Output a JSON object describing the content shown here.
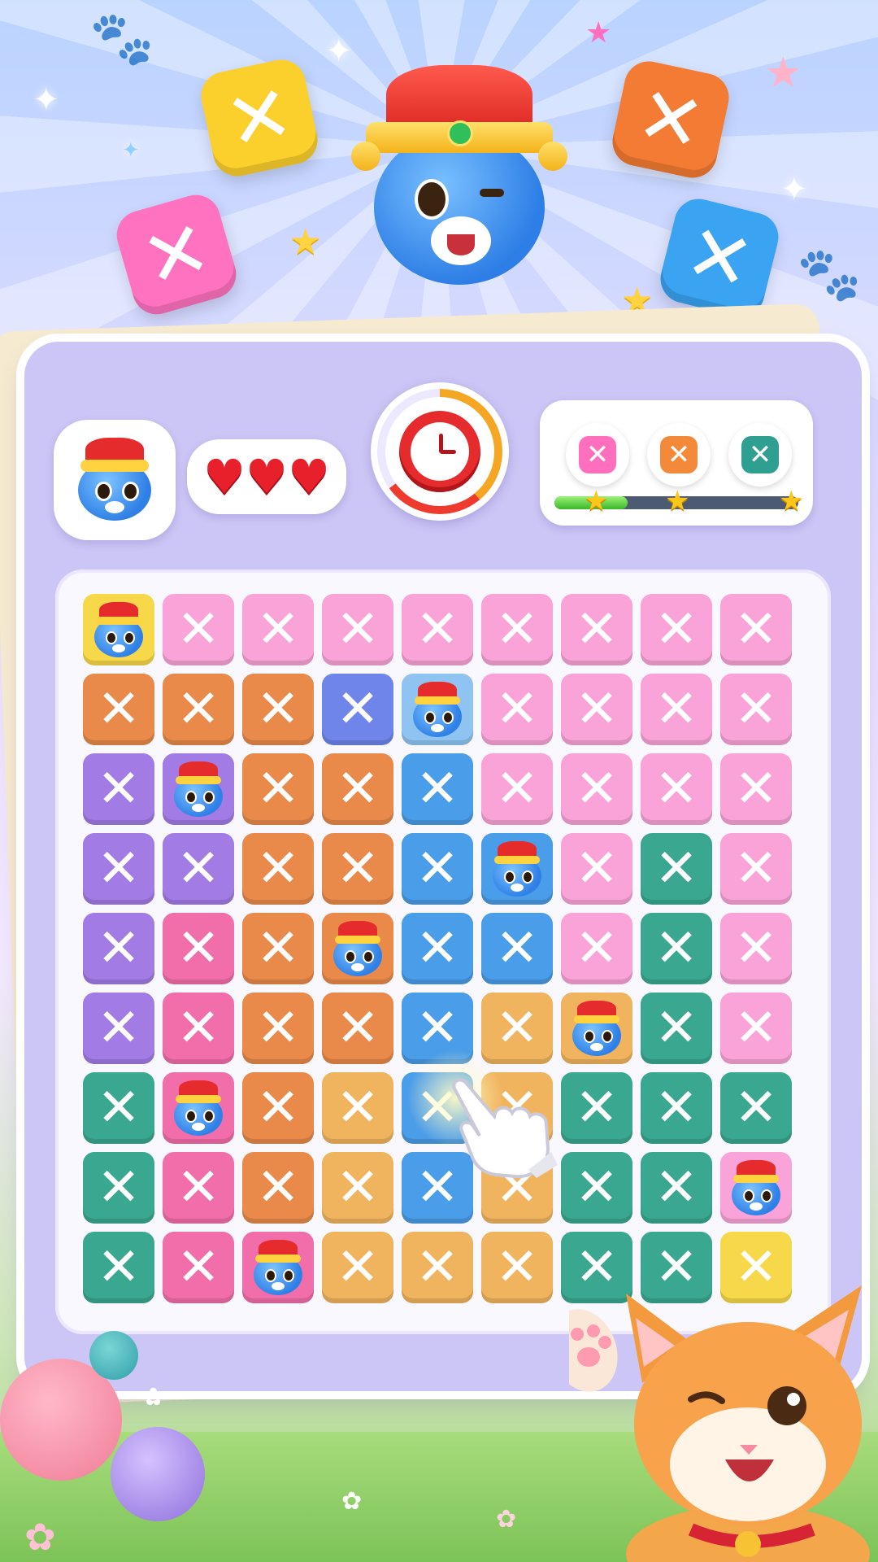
{
  "hud": {
    "lives": "♥♥♥",
    "timer_progress": 0.65,
    "goal_progress": 0.3,
    "goals": [
      {
        "symbol": "✕",
        "color": "#ff6fbe"
      },
      {
        "symbol": "✕",
        "color": "#f28a3a"
      },
      {
        "symbol": "✕",
        "color": "#2f9f92"
      }
    ],
    "stars": [
      "★",
      "★",
      "★"
    ]
  },
  "board": {
    "tile_symbol": "✕",
    "colors": {
      "P": "#f9a3d8",
      "O": "#e98a4b",
      "B": "#4a9de8",
      "V": "#a27be5",
      "G": "#3aa891",
      "R": "#f26eaa",
      "L": "#f1b45e",
      "Y": "#f7d84a",
      "N": "#6f85ea",
      "S": "#8fc4f2"
    },
    "rows": [
      [
        "Yc",
        "P",
        "P",
        "P",
        "P",
        "P",
        "P",
        "P",
        "P"
      ],
      [
        "O",
        "O",
        "O",
        "N",
        "Sc",
        "P",
        "P",
        "P",
        "P"
      ],
      [
        "V",
        "Vc",
        "O",
        "O",
        "B",
        "P",
        "P",
        "P",
        "P"
      ],
      [
        "V",
        "V",
        "O",
        "O",
        "B",
        "Bc",
        "P",
        "G",
        "P"
      ],
      [
        "V",
        "R",
        "O",
        "Oc",
        "B",
        "B",
        "P",
        "G",
        "P"
      ],
      [
        "V",
        "R",
        "O",
        "O",
        "B",
        "L",
        "Lc",
        "G",
        "P"
      ],
      [
        "G",
        "Rc",
        "O",
        "L",
        "B",
        "L",
        "G",
        "G",
        "G"
      ],
      [
        "G",
        "R",
        "O",
        "L",
        "B",
        "L",
        "G",
        "G",
        "Pc"
      ],
      [
        "G",
        "R",
        "Rc",
        "L",
        "L",
        "L",
        "G",
        "G",
        "Y"
      ]
    ]
  },
  "decor": {
    "badge_symbol": "✕",
    "paw": "🐾",
    "sparkle": "✦",
    "star": "★",
    "flower": "✿"
  }
}
